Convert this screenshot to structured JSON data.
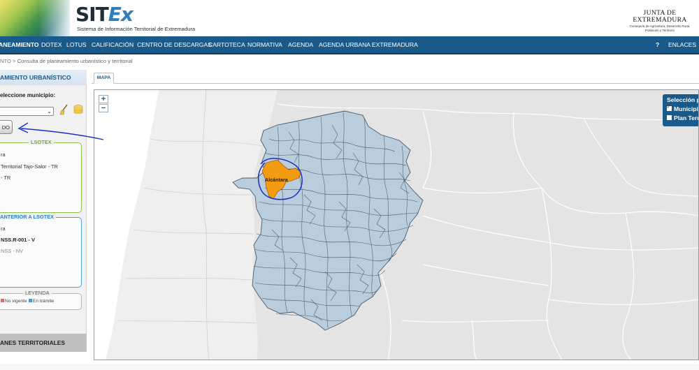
{
  "header": {
    "logo_main": "SIT",
    "logo_accent": "Ex",
    "logo_subtitle": "Sistema de Información Territorial de Extremadura",
    "junta_title": "JUNTA DE EXTREMADURA",
    "junta_sub_1": "Consejería de Agricultura, Desarrollo Rural,",
    "junta_sub_2": "Población y Territorio"
  },
  "nav": {
    "items": [
      "ANEAMIENTO",
      "DOTEX",
      "LOTUS",
      "CALIFICACIÓN",
      "CENTRO DE DESCARGAS",
      "CARTOTECA",
      "NORMATIVA",
      "AGENDA",
      "AGENDA URBANA EXTREMADURA"
    ],
    "help": "?",
    "links": "ENLACES"
  },
  "breadcrumb": {
    "parent": "NTO",
    "separator": ">",
    "current": "Consulta de planeamiento urbanístico y territorial"
  },
  "sidebar": {
    "title": "AMIENTO URBANÍSTICO",
    "municipio_label": "eleccione municipio:",
    "search_button": "DO",
    "lsotex": {
      "legend": "LSOTEX",
      "line1": "ra",
      "line2": "Territorial Tajo-Salor - TR",
      "line3": "- TR"
    },
    "anterior": {
      "legend": "ANTERIOR A LSOTEX",
      "line1": "ra",
      "line2": "NSS.R-001 - V",
      "line3": "NSS - NV"
    },
    "leyenda": {
      "legend": "LEYENDA",
      "no_vigente": "No vigente",
      "en_tramite": "En trámite",
      "colors": {
        "no_vigente": "#e26a6a",
        "en_tramite": "#3aa0e0"
      }
    },
    "footer": "ANES TERRITORIALES"
  },
  "map": {
    "tab": "MAPA",
    "zoom_in": "+",
    "zoom_out": "−",
    "selected_municipio": "Alcántara",
    "layers": {
      "title": "Selección po",
      "municipios": "Municipi",
      "plan_territorial": "Plan Terr",
      "municipios_checked": true,
      "plan_checked": false
    },
    "colors": {
      "region_fill": "#b9cddc",
      "selected_fill": "#f39c12",
      "annotation": "#1a2fc4",
      "land": "#e4e4e4",
      "sea": "#ffffff",
      "portugal": "#efefef"
    }
  }
}
